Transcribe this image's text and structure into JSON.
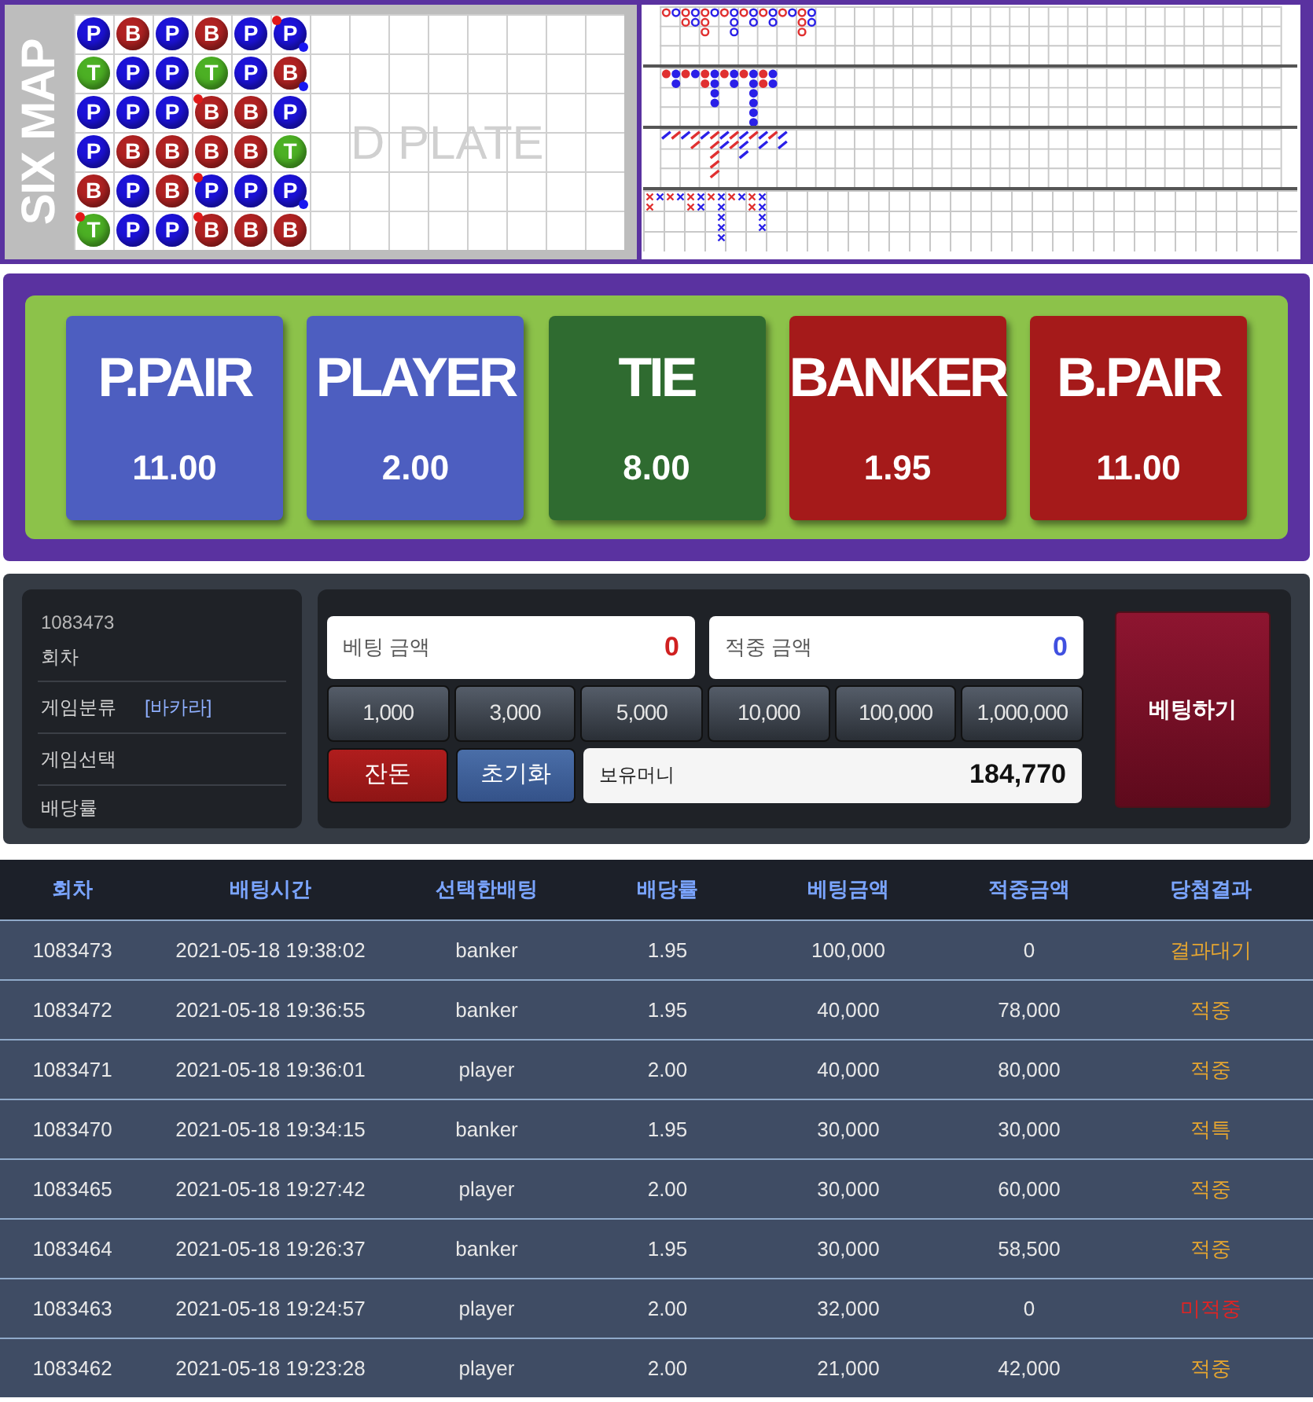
{
  "bead_plate": {
    "label": "SIX MAP",
    "watermark": "D PLATE",
    "columns": [
      [
        {
          "kind": "player",
          "letter": "P",
          "banker_pair": false,
          "player_pair": false
        },
        {
          "kind": "tie",
          "letter": "T",
          "banker_pair": false,
          "player_pair": false
        },
        {
          "kind": "player",
          "letter": "P",
          "banker_pair": false,
          "player_pair": false
        },
        {
          "kind": "player",
          "letter": "P",
          "banker_pair": false,
          "player_pair": false
        },
        {
          "kind": "banker",
          "letter": "B",
          "banker_pair": false,
          "player_pair": false
        },
        {
          "kind": "tie",
          "letter": "T",
          "banker_pair": true,
          "player_pair": false
        }
      ],
      [
        {
          "kind": "banker",
          "letter": "B",
          "banker_pair": false,
          "player_pair": false
        },
        {
          "kind": "player",
          "letter": "P",
          "banker_pair": false,
          "player_pair": false
        },
        {
          "kind": "player",
          "letter": "P",
          "banker_pair": false,
          "player_pair": false
        },
        {
          "kind": "banker",
          "letter": "B",
          "banker_pair": false,
          "player_pair": false
        },
        {
          "kind": "player",
          "letter": "P",
          "banker_pair": false,
          "player_pair": false
        },
        {
          "kind": "player",
          "letter": "P",
          "banker_pair": false,
          "player_pair": false
        }
      ],
      [
        {
          "kind": "player",
          "letter": "P",
          "banker_pair": false,
          "player_pair": false
        },
        {
          "kind": "player",
          "letter": "P",
          "banker_pair": false,
          "player_pair": false
        },
        {
          "kind": "player",
          "letter": "P",
          "banker_pair": false,
          "player_pair": false
        },
        {
          "kind": "banker",
          "letter": "B",
          "banker_pair": false,
          "player_pair": false
        },
        {
          "kind": "banker",
          "letter": "B",
          "banker_pair": false,
          "player_pair": false
        },
        {
          "kind": "player",
          "letter": "P",
          "banker_pair": false,
          "player_pair": false
        }
      ],
      [
        {
          "kind": "banker",
          "letter": "B",
          "banker_pair": false,
          "player_pair": false
        },
        {
          "kind": "tie",
          "letter": "T",
          "banker_pair": false,
          "player_pair": false
        },
        {
          "kind": "banker",
          "letter": "B",
          "banker_pair": true,
          "player_pair": false
        },
        {
          "kind": "banker",
          "letter": "B",
          "banker_pair": false,
          "player_pair": false
        },
        {
          "kind": "player",
          "letter": "P",
          "banker_pair": true,
          "player_pair": false
        },
        {
          "kind": "banker",
          "letter": "B",
          "banker_pair": true,
          "player_pair": false
        }
      ],
      [
        {
          "kind": "player",
          "letter": "P",
          "banker_pair": false,
          "player_pair": false
        },
        {
          "kind": "player",
          "letter": "P",
          "banker_pair": false,
          "player_pair": false
        },
        {
          "kind": "banker",
          "letter": "B",
          "banker_pair": false,
          "player_pair": false
        },
        {
          "kind": "banker",
          "letter": "B",
          "banker_pair": false,
          "player_pair": false
        },
        {
          "kind": "player",
          "letter": "P",
          "banker_pair": false,
          "player_pair": false
        },
        {
          "kind": "banker",
          "letter": "B",
          "banker_pair": false,
          "player_pair": false
        }
      ],
      [
        {
          "kind": "player",
          "letter": "P",
          "banker_pair": true,
          "player_pair": true
        },
        {
          "kind": "banker",
          "letter": "B",
          "banker_pair": false,
          "player_pair": true
        },
        {
          "kind": "player",
          "letter": "P",
          "banker_pair": false,
          "player_pair": false
        },
        {
          "kind": "tie",
          "letter": "T",
          "banker_pair": false,
          "player_pair": false
        },
        {
          "kind": "player",
          "letter": "P",
          "banker_pair": false,
          "player_pair": true
        },
        {
          "kind": "banker",
          "letter": "B",
          "banker_pair": false,
          "player_pair": false
        }
      ]
    ]
  },
  "roads": [
    {
      "kind": "ring"
    },
    {
      "kind": "dot"
    },
    {
      "kind": "slash"
    },
    {
      "kind": "cross"
    }
  ],
  "bet_options": [
    {
      "kind": "player",
      "label": "P.PAIR",
      "odds": "11.00"
    },
    {
      "kind": "player",
      "label": "PLAYER",
      "odds": "2.00"
    },
    {
      "kind": "tie",
      "label": "TIE",
      "odds": "8.00"
    },
    {
      "kind": "banker",
      "label": "BANKER",
      "odds": "1.95"
    },
    {
      "kind": "banker",
      "label": "B.PAIR",
      "odds": "11.00"
    }
  ],
  "info": {
    "round_number": "1083473",
    "round_label": "회차",
    "category_label": "게임분류",
    "category_value": "[바카라]",
    "selection_label": "게임선택",
    "odds_label": "배당률"
  },
  "bet_form": {
    "bet_amount_label": "베팅 금액",
    "bet_amount": "0",
    "win_amount_label": "적중 금액",
    "win_amount": "0",
    "chips": [
      "1,000",
      "3,000",
      "5,000",
      "10,000",
      "100,000",
      "1,000,000"
    ],
    "change_button": "잔돈",
    "reset_button": "초기화",
    "balance_label": "보유머니",
    "balance": "184,770",
    "bet_button": "베팅하기"
  },
  "history": {
    "columns": [
      "회차",
      "배팅시간",
      "선택한배팅",
      "배당률",
      "베팅금액",
      "적중금액",
      "당첨결과"
    ],
    "rows": [
      {
        "round": "1083473",
        "time": "2021-05-18 19:38:02",
        "choice": "banker",
        "odds": "1.95",
        "bet": "100,000",
        "won": "0",
        "result": "결과대기",
        "kind": "pending"
      },
      {
        "round": "1083472",
        "time": "2021-05-18 19:36:55",
        "choice": "banker",
        "odds": "1.95",
        "bet": "40,000",
        "won": "78,000",
        "result": "적중",
        "kind": "win"
      },
      {
        "round": "1083471",
        "time": "2021-05-18 19:36:01",
        "choice": "player",
        "odds": "2.00",
        "bet": "40,000",
        "won": "80,000",
        "result": "적중",
        "kind": "win"
      },
      {
        "round": "1083470",
        "time": "2021-05-18 19:34:15",
        "choice": "banker",
        "odds": "1.95",
        "bet": "30,000",
        "won": "30,000",
        "result": "적특",
        "kind": "special"
      },
      {
        "round": "1083465",
        "time": "2021-05-18 19:27:42",
        "choice": "player",
        "odds": "2.00",
        "bet": "30,000",
        "won": "60,000",
        "result": "적중",
        "kind": "win"
      },
      {
        "round": "1083464",
        "time": "2021-05-18 19:26:37",
        "choice": "banker",
        "odds": "1.95",
        "bet": "30,000",
        "won": "58,500",
        "result": "적중",
        "kind": "win"
      },
      {
        "round": "1083463",
        "time": "2021-05-18 19:24:57",
        "choice": "player",
        "odds": "2.00",
        "bet": "32,000",
        "won": "0",
        "result": "미적중",
        "kind": "lose"
      },
      {
        "round": "1083462",
        "time": "2021-05-18 19:23:28",
        "choice": "player",
        "odds": "2.00",
        "bet": "21,000",
        "won": "42,000",
        "result": "적중",
        "kind": "win"
      }
    ]
  }
}
